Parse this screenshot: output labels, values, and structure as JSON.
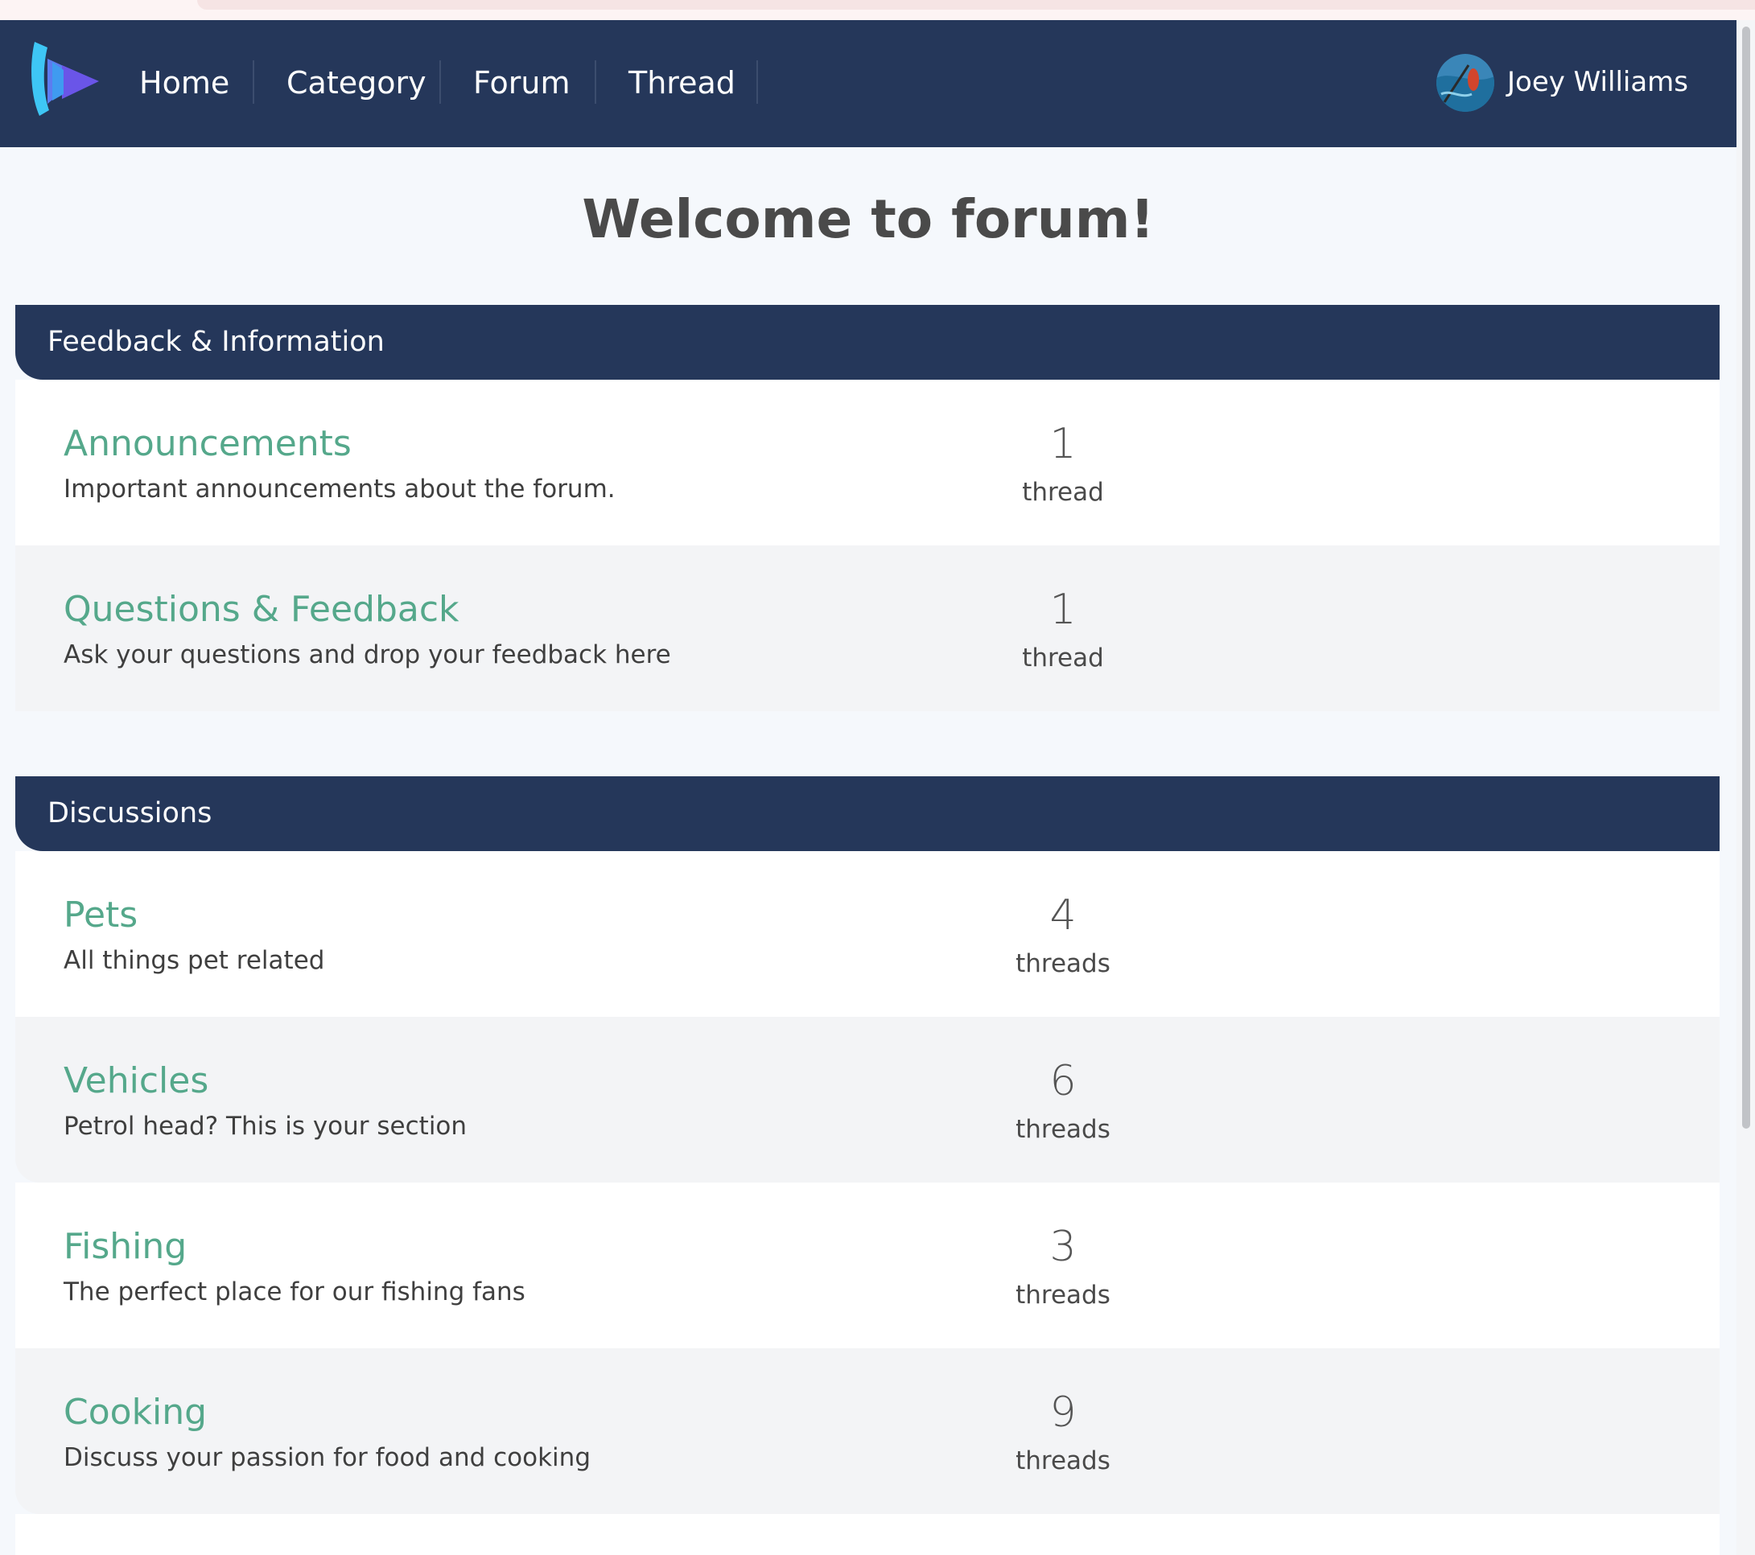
{
  "nav": {
    "items": [
      {
        "label": "Home"
      },
      {
        "label": "Category"
      },
      {
        "label": "Forum"
      },
      {
        "label": "Thread"
      }
    ],
    "user": {
      "name": "Joey Williams"
    }
  },
  "page": {
    "title": "Welcome to forum!"
  },
  "sections": [
    {
      "title": "Feedback & Information",
      "forums": [
        {
          "name": "Announcements",
          "description": "Important announcements about the forum.",
          "count": "1",
          "count_label": "thread"
        },
        {
          "name": "Questions & Feedback",
          "description": "Ask your questions and drop your feedback here",
          "count": "1",
          "count_label": "thread"
        }
      ]
    },
    {
      "title": "Discussions",
      "forums": [
        {
          "name": "Pets",
          "description": "All things pet related",
          "count": "4",
          "count_label": "threads"
        },
        {
          "name": "Vehicles",
          "description": "Petrol head? This is your section",
          "count": "6",
          "count_label": "threads"
        },
        {
          "name": "Fishing",
          "description": "The perfect place for our fishing fans",
          "count": "3",
          "count_label": "threads"
        },
        {
          "name": "Cooking",
          "description": "Discuss your passion for food and cooking",
          "count": "9",
          "count_label": "threads"
        }
      ]
    }
  ],
  "colors": {
    "navbar": "#25375a",
    "forum_link": "#55a88b",
    "page_background": "#f5f8fc",
    "row_alt": "#f3f4f6"
  },
  "icons": [
    "logo-icon",
    "avatar"
  ]
}
